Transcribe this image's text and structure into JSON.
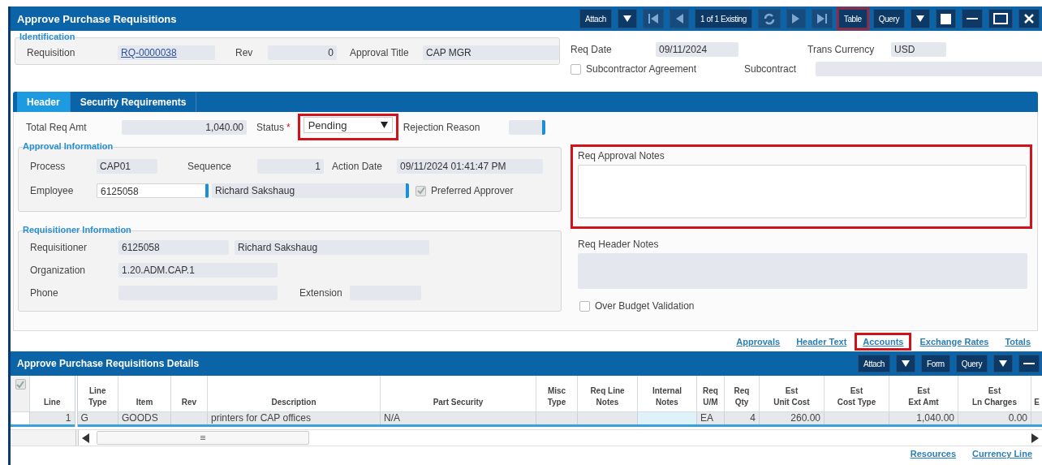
{
  "window": {
    "title": "Approve Purchase Requisitions"
  },
  "toolbar": [
    {
      "kind": "text",
      "label": "Attach",
      "disabled": false,
      "highlighted": false
    },
    {
      "kind": "dropdown",
      "disabled": false,
      "highlighted": false
    },
    {
      "kind": "first",
      "disabled": true,
      "highlighted": false
    },
    {
      "kind": "prev",
      "disabled": true,
      "highlighted": false
    },
    {
      "kind": "counter",
      "label": "1 of 1 Existing",
      "disabled": false,
      "highlighted": false
    },
    {
      "kind": "refresh",
      "disabled": true,
      "highlighted": false
    },
    {
      "kind": "next",
      "disabled": true,
      "highlighted": false
    },
    {
      "kind": "last",
      "disabled": true,
      "highlighted": false
    },
    {
      "kind": "text",
      "label": "Table",
      "disabled": false,
      "highlighted": true
    },
    {
      "kind": "text",
      "label": "Query",
      "disabled": false,
      "highlighted": false
    },
    {
      "kind": "dropdown",
      "disabled": false,
      "highlighted": false
    },
    {
      "kind": "square",
      "disabled": false,
      "highlighted": false
    },
    {
      "kind": "minimize",
      "disabled": false,
      "highlighted": false
    },
    {
      "kind": "maximize",
      "disabled": false,
      "highlighted": false
    },
    {
      "kind": "close",
      "disabled": false,
      "highlighted": false
    }
  ],
  "identification": {
    "legend": "Identification",
    "requisition": {
      "label": "Requisition",
      "value": "RQ-0000038"
    },
    "rev": {
      "label": "Rev",
      "value": "0"
    },
    "approval_title": {
      "label": "Approval Title",
      "value": "CAP MGR"
    }
  },
  "req_date": {
    "label": "Req Date",
    "value": "09/11/2024"
  },
  "trans_currency": {
    "label": "Trans Currency",
    "value": "USD"
  },
  "subcontractor_agreement": {
    "label": "Subcontractor Agreement",
    "checked": false
  },
  "subcontract": {
    "label": "Subcontract"
  },
  "tabs": [
    {
      "label": "Header",
      "selected": true
    },
    {
      "label": "Security Requirements",
      "selected": false
    }
  ],
  "total_req_amt": {
    "label": "Total Req Amt",
    "value": "1,040.00"
  },
  "status": {
    "label": "Status",
    "required_mark": "*",
    "value": "Pending",
    "highlighted": true
  },
  "rejection_reason": {
    "label": "Rejection Reason"
  },
  "approval_information": {
    "legend": "Approval Information",
    "process": {
      "label": "Process",
      "value": "CAP01"
    },
    "sequence": {
      "label": "Sequence",
      "value": "1"
    },
    "action_date": {
      "label": "Action Date",
      "value": "09/11/2024 01:41:47 PM"
    },
    "employee": {
      "label": "Employee",
      "value": "6125058",
      "name": "Richard Sakshaug"
    },
    "preferred_approver": {
      "label": "Preferred Approver",
      "checked": true,
      "disabled": true
    }
  },
  "requisitioner_information": {
    "legend": "Requisitioner Information",
    "requisitioner": {
      "label": "Requisitioner",
      "value": "6125058",
      "name": "Richard Sakshaug"
    },
    "organization": {
      "label": "Organization",
      "value": "1.20.ADM.CAP.1"
    },
    "phone": {
      "label": "Phone"
    },
    "extension": {
      "label": "Extension"
    }
  },
  "req_approval_notes": {
    "label": "Req Approval Notes",
    "highlighted": true
  },
  "req_header_notes": {
    "label": "Req Header Notes"
  },
  "over_budget_validation": {
    "label": "Over Budget Validation",
    "checked": false
  },
  "links": [
    {
      "label": "Approvals",
      "highlighted": false
    },
    {
      "label": "Header Text",
      "highlighted": false
    },
    {
      "label": "Accounts",
      "highlighted": true
    },
    {
      "label": "Exchange Rates",
      "highlighted": false
    },
    {
      "label": "Totals",
      "highlighted": false
    }
  ],
  "details": {
    "title": "Approve Purchase Requisitions Details",
    "toolbar": [
      {
        "kind": "text",
        "label": "Attach"
      },
      {
        "kind": "dropdown"
      },
      {
        "kind": "text",
        "label": "Form"
      },
      {
        "kind": "text",
        "label": "Query"
      },
      {
        "kind": "dropdown"
      },
      {
        "kind": "minimize"
      }
    ],
    "table": {
      "select_all_checked": true,
      "columns": [
        {
          "label": "Line",
          "numeric": true,
          "editable": false
        },
        {
          "label": "Line\nType",
          "numeric": false,
          "editable": false
        },
        {
          "label": "Item",
          "numeric": false,
          "editable": false
        },
        {
          "label": "Rev",
          "editable": false
        },
        {
          "label": "Description",
          "numeric": false,
          "editable": false
        },
        {
          "label": "Part Security",
          "numeric": false,
          "editable": false
        },
        {
          "label": "Misc\nType",
          "editable": false
        },
        {
          "label": "Req Line\nNotes",
          "editable": false
        },
        {
          "label": "Internal\nNotes",
          "numeric": false,
          "editable": true
        },
        {
          "label": "Req\nU/M",
          "numeric": false,
          "editable": false
        },
        {
          "label": "Req\nQty",
          "numeric": true,
          "editable": false
        },
        {
          "label": "Est\nUnit Cost",
          "numeric": true,
          "editable": false
        },
        {
          "label": "Est\nCost Type",
          "editable": false
        },
        {
          "label": "Est\nExt Amt",
          "numeric": true,
          "editable": false
        },
        {
          "label": "Est\nLn Charges",
          "numeric": true,
          "editable": false
        },
        {
          "label": "E",
          "editable": false
        }
      ],
      "rows": [
        {
          "cells": [
            "1",
            "G",
            "GOODS",
            null,
            "printers for CAP offices",
            "N/A",
            null,
            null,
            null,
            "EA",
            "4",
            "260.00",
            null,
            "1,040.00",
            "0.00",
            null
          ]
        }
      ]
    },
    "links": [
      {
        "label": "Resources"
      },
      {
        "label": "Currency Line"
      }
    ]
  }
}
